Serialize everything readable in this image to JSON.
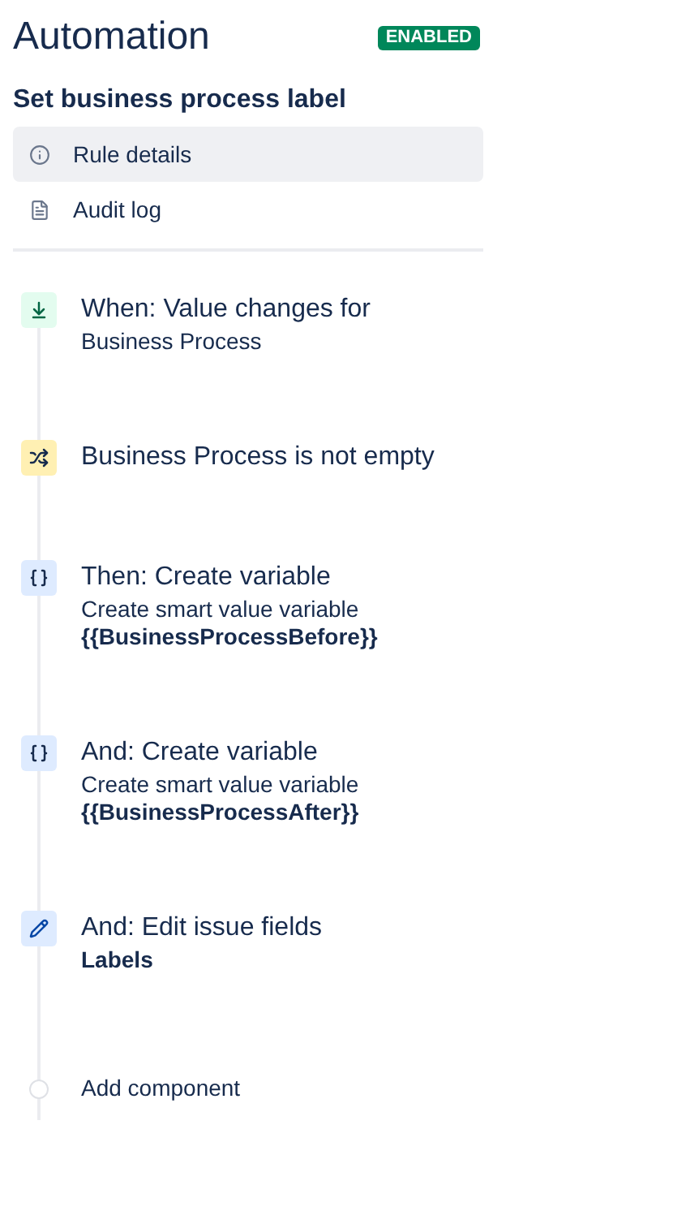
{
  "header": {
    "title": "Automation",
    "status": "ENABLED",
    "enabled": true
  },
  "rule_name": "Set business process label",
  "nav": [
    {
      "label": "Rule details",
      "kind": "info",
      "selected": true
    },
    {
      "label": "Audit log",
      "kind": "log",
      "selected": false
    }
  ],
  "steps": [
    {
      "kind": "trigger",
      "title": "When: Value changes for",
      "details": [
        {
          "text": "Business Process",
          "bold": false
        }
      ]
    },
    {
      "kind": "condition",
      "title": "Business Process is not empty"
    },
    {
      "kind": "variable",
      "title": "Then: Create variable",
      "details": [
        {
          "text": "Create smart value variable",
          "bold": false
        },
        {
          "text": "{{BusinessProcessBefore}}",
          "bold": true
        }
      ]
    },
    {
      "kind": "variable",
      "title": "And: Create variable",
      "details": [
        {
          "text": "Create smart value variable",
          "bold": false
        },
        {
          "text": "{{BusinessProcessAfter}}",
          "bold": true
        }
      ]
    },
    {
      "kind": "edit",
      "title": "And: Edit issue fields",
      "details": [
        {
          "text": "Labels",
          "bold": true
        }
      ]
    }
  ],
  "add_component": "Add component"
}
